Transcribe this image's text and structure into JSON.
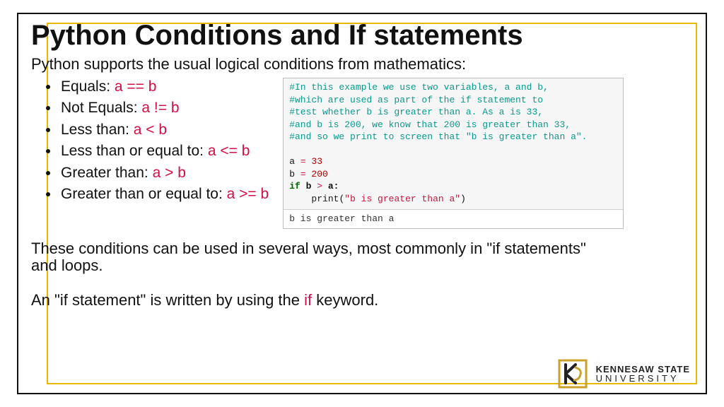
{
  "title": "Python Conditions and If statements",
  "intro": "Python supports the usual logical conditions from mathematics:",
  "bullets": [
    {
      "label": "Equals: ",
      "code": "a == b"
    },
    {
      "label": "Not Equals: ",
      "code": "a != b"
    },
    {
      "label": "Less than: ",
      "code": "a < b"
    },
    {
      "label": "Less than or equal to: ",
      "code": "a <= b"
    },
    {
      "label": "Greater than: ",
      "code": "a > b"
    },
    {
      "label": "Greater than or equal to: ",
      "code": "a >= b"
    }
  ],
  "code_example": {
    "comments": [
      "#In this example we use two variables, a and b,",
      "#which are used as part of the if statement to",
      "#test whether b is greater than a. As a is 33,",
      "#and b is 200, we know that 200 is greater than 33,",
      "#and so we print to screen that \"b is greater than a\"."
    ],
    "line_a_var": "a",
    "line_a_eq": " = ",
    "line_a_val": "33",
    "line_b_var": "b",
    "line_b_eq": " = ",
    "line_b_val": "200",
    "if_kw": "if",
    "if_body": " b ",
    "if_op": ">",
    "if_body2": " a:",
    "print_indent": "    ",
    "print_fn": "print",
    "print_open": "(",
    "print_str": "\"b is greater than a\"",
    "print_close": ")",
    "output": "b is greater than a"
  },
  "para1": "These conditions can be used in several ways, most commonly in \"if statements\" and loops.",
  "para2_a": "An \"if statement\" is written by using the ",
  "para2_if": "if",
  "para2_b": " keyword.",
  "logo": {
    "line1": "KENNESAW STATE",
    "line2": "UNIVERSITY"
  }
}
